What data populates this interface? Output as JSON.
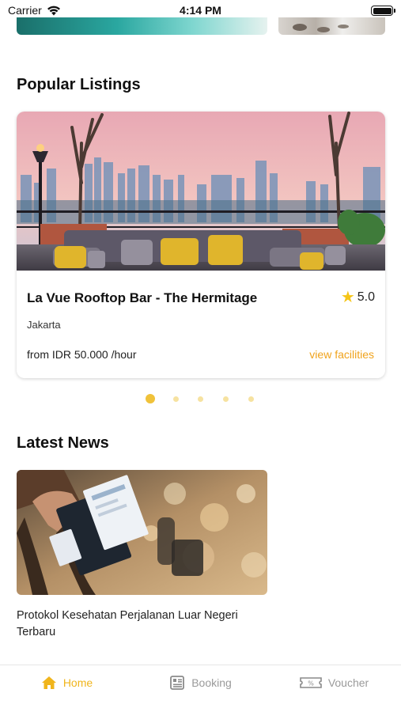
{
  "status_bar": {
    "carrier": "Carrier",
    "time": "4:14 PM"
  },
  "sections": {
    "popular_title": "Popular Listings",
    "news_title": "Latest News"
  },
  "listing": {
    "name": "La Vue Rooftop Bar - The Hermitage",
    "rating": "5.0",
    "city": "Jakarta",
    "price": "from IDR 50.000 /hour",
    "link_label": "view facilities",
    "image_icon": "rooftop-bar-photo"
  },
  "carousel": {
    "count": 5,
    "active_index": 0
  },
  "news": {
    "title": "Protokol Kesehatan Perjalanan Luar Negeri Terbaru",
    "image_icon": "traveler-passport-photo"
  },
  "tabs": [
    {
      "label": "Home",
      "icon": "home-icon",
      "active": true
    },
    {
      "label": "Booking",
      "icon": "booking-icon",
      "active": false
    },
    {
      "label": "Voucher",
      "icon": "voucher-icon",
      "active": false
    }
  ],
  "colors": {
    "accent": "#f0b51c",
    "link": "#f0a31c",
    "star": "#f5c518",
    "inactive": "#9a9a9a"
  }
}
